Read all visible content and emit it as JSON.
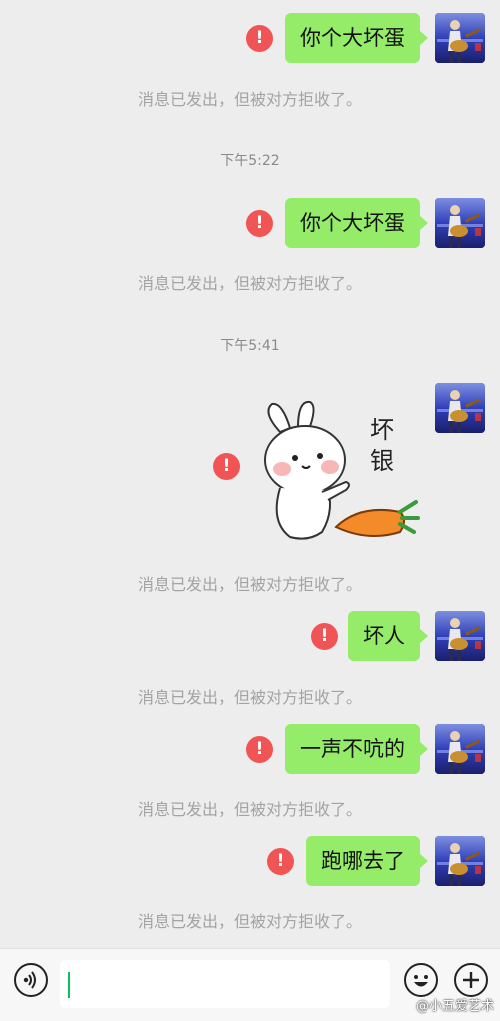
{
  "messages": [
    {
      "text": "你个大坏蛋",
      "notice": "消息已发出，但被对方拒收了。"
    },
    {
      "text": "你个大坏蛋",
      "notice": "消息已发出，但被对方拒收了。"
    },
    {
      "sticker_text": "坏银",
      "notice": "消息已发出，但被对方拒收了。"
    },
    {
      "text": "坏人",
      "notice": "消息已发出，但被对方拒收了。"
    },
    {
      "text": "一声不吭的",
      "notice": "消息已发出，但被对方拒收了。"
    },
    {
      "text": "跑哪去了",
      "notice": "消息已发出，但被对方拒收了。"
    }
  ],
  "timestamps": [
    "下午5:22",
    "下午5:41"
  ],
  "error_mark": "!",
  "input": {
    "value": ""
  },
  "watermark": "@小五爱艺术",
  "icons": {
    "voice": "voice-icon",
    "emoji": "emoji-icon",
    "plus": "plus-icon",
    "error": "error-icon"
  },
  "colors": {
    "bubble": "#95ec69",
    "error": "#f15454",
    "background": "#ededed"
  }
}
